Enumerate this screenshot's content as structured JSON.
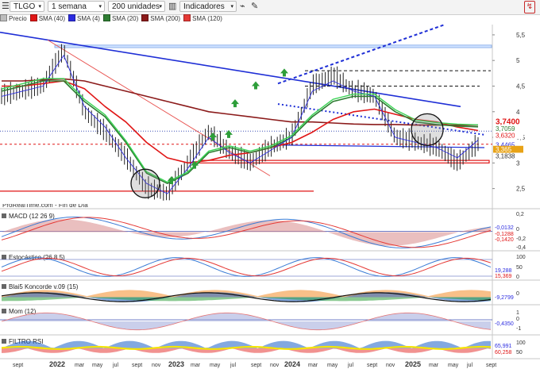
{
  "toolbar": {
    "symbol": "TLGO",
    "period": "1 semana",
    "units": "200 unidades",
    "indicators": "Indicadores",
    "menu_icon": "hamburger-menu-icon",
    "chart_icon": "candlestick-icon",
    "link_icon": "link-icon",
    "tools_icon": "tools-icon",
    "logo": "prorealtime-logo-icon"
  },
  "legend": [
    {
      "label": "Precio",
      "color": "#bdbdbd"
    },
    {
      "label": "SMA (40)",
      "color": "#e01616"
    },
    {
      "label": "SMA (4)",
      "color": "#2c2ce0"
    },
    {
      "label": "SMA (20)",
      "color": "#2e7d32"
    },
    {
      "label": "SMA (200)",
      "color": "#8b1a1a"
    },
    {
      "label": "SMA (120)",
      "color": "#e53935"
    }
  ],
  "source_label": "ProRealTime.com - Fin de Día",
  "price_axis": {
    "ticks": [
      "5,5",
      "5",
      "4,5",
      "4",
      "3,5",
      "3",
      "2,5"
    ],
    "badges": [
      {
        "text": "3,7400",
        "color": "#e01616",
        "fill": "#ffffff"
      },
      {
        "text": "3,7059",
        "color": "#2e7d32",
        "fill": "#ffffff"
      },
      {
        "text": "3,6320",
        "color": "#e01616",
        "fill": "#ffffff"
      },
      {
        "text": "3,4465",
        "color": "#2c2ce0",
        "fill": "#ffffff"
      },
      {
        "text": "3,365",
        "color": "#ffffff",
        "fill": "#e8a317"
      },
      {
        "text": "3,1838",
        "color": "#333333",
        "fill": "#ffffff"
      }
    ]
  },
  "panels": {
    "macd": {
      "label": "MACD (12 26 9)",
      "ticks": [
        "0,2",
        "0",
        "-0,2",
        "-0,4"
      ],
      "badges": [
        "-0,0132",
        "-0,1288",
        "-0,1420"
      ]
    },
    "stoch": {
      "label": "Estocástico (26 8 5)",
      "ticks": [
        "100",
        "50",
        "0"
      ],
      "badges": [
        "19,288",
        "15,369"
      ]
    },
    "blai": {
      "label": "Blai5 Koncorde v.09 (15)",
      "ticks": [
        "0"
      ],
      "badges": [
        "-9,2799"
      ]
    },
    "mom": {
      "label": "Mom (12)",
      "ticks": [
        "1",
        "0",
        "-1"
      ],
      "badges": [
        "-0,4350"
      ]
    },
    "rsi": {
      "label": "FILTRO RSI",
      "ticks": [
        "100",
        "50"
      ],
      "badges": [
        "65,991",
        "60,258"
      ]
    }
  },
  "x_axis": {
    "ticks": [
      "sept",
      "2022",
      "mar",
      "may",
      "jul",
      "sept",
      "nov",
      "2023",
      "mar",
      "may",
      "jul",
      "sept",
      "nov",
      "2024",
      "mar",
      "may",
      "jul",
      "sept",
      "nov",
      "2025",
      "mar",
      "may",
      "jul",
      "sept"
    ]
  },
  "chart_data": {
    "type": "line",
    "title": "TLGO",
    "ylim": [
      2.2,
      5.7
    ],
    "series": [
      {
        "name": "Precio",
        "x": [
          "2021-08",
          "2021-10",
          "2021-12",
          "2022-02",
          "2022-04",
          "2022-06",
          "2022-08",
          "2022-10",
          "2022-12",
          "2023-02",
          "2023-04",
          "2023-06",
          "2023-08",
          "2023-10",
          "2023-12",
          "2024-02",
          "2024-04",
          "2024-06",
          "2024-08",
          "2024-10",
          "2024-12",
          "2025-02",
          "2025-04",
          "2025-05"
        ],
        "values": [
          4.3,
          4.4,
          4.5,
          5.2,
          4.0,
          3.6,
          3.1,
          2.5,
          2.4,
          3.0,
          3.6,
          3.2,
          3.0,
          3.3,
          3.5,
          4.5,
          4.7,
          4.4,
          4.3,
          3.5,
          3.4,
          3.3,
          3.0,
          3.365
        ]
      },
      {
        "name": "SMA (40)",
        "values": [
          4.5,
          4.5,
          4.55,
          4.6,
          4.45,
          4.1,
          3.8,
          3.4,
          3.1,
          3.0,
          3.05,
          3.15,
          3.2,
          3.3,
          3.4,
          3.6,
          3.85,
          4.0,
          4.05,
          3.95,
          3.85,
          3.8,
          3.7,
          3.632
        ]
      },
      {
        "name": "SMA (20)",
        "values": [
          4.4,
          4.5,
          4.6,
          4.6,
          4.2,
          3.9,
          3.4,
          2.8,
          2.6,
          2.8,
          3.2,
          3.3,
          3.2,
          3.3,
          3.5,
          3.9,
          4.2,
          4.3,
          4.3,
          4.0,
          3.8,
          3.75,
          3.72,
          3.7059
        ]
      },
      {
        "name": "SMA (200)",
        "values": [
          4.6,
          4.6,
          4.62,
          4.64,
          4.6,
          4.5,
          4.4,
          4.3,
          4.2,
          4.1,
          4.0,
          3.95,
          3.9,
          3.85,
          3.8,
          3.8,
          3.78,
          3.76,
          3.75,
          3.75,
          3.74,
          3.74,
          3.74,
          3.74
        ]
      },
      {
        "name": "SMA (4)",
        "values": [
          4.3,
          4.4,
          4.5,
          5.1,
          4.1,
          3.7,
          3.1,
          2.6,
          2.4,
          2.9,
          3.5,
          3.2,
          3.0,
          3.25,
          3.5,
          4.4,
          4.6,
          4.4,
          4.3,
          3.5,
          3.4,
          3.3,
          3.1,
          3.4465
        ]
      }
    ],
    "annotations": {
      "support_zone": [
        3.05,
        3.0
      ],
      "resistance_zone": [
        5.3,
        5.25
      ],
      "horizontal_lines": [
        4.8,
        4.5,
        2.45
      ],
      "last_price": 3.365
    }
  }
}
